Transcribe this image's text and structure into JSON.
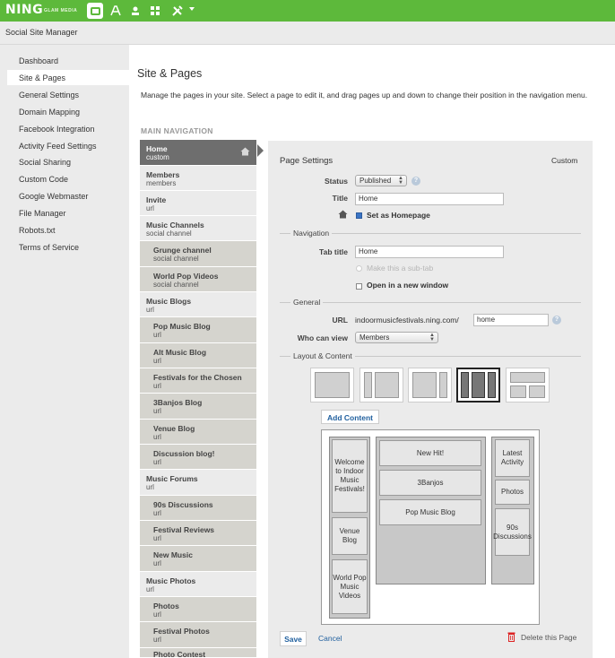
{
  "topbar": {
    "logo": "NING",
    "logo_sub": "GLAM MEDIA",
    "icons": [
      "manage-icon",
      "appearance-icon",
      "members-icon",
      "features-icon",
      "tools-icon"
    ]
  },
  "subheader": {
    "title": "Social Site Manager"
  },
  "sidebar": {
    "items": [
      {
        "label": "Dashboard"
      },
      {
        "label": "Site & Pages",
        "active": true
      },
      {
        "label": "General Settings"
      },
      {
        "label": "Domain Mapping"
      },
      {
        "label": "Facebook Integration"
      },
      {
        "label": "Activity Feed Settings"
      },
      {
        "label": "Social Sharing"
      },
      {
        "label": "Custom Code"
      },
      {
        "label": "Google Webmaster"
      },
      {
        "label": "File Manager"
      },
      {
        "label": "Robots.txt"
      },
      {
        "label": "Terms of Service"
      }
    ]
  },
  "main": {
    "title": "Site & Pages",
    "intro": "Manage the pages in your site. Select a page to edit it, and drag pages up and down to change their position in the navigation menu.",
    "nav_heading": "MAIN NAVIGATION",
    "pages": [
      {
        "name": "Home",
        "type": "custom",
        "level": 0,
        "selected": true
      },
      {
        "name": "Members",
        "type": "members",
        "level": 0
      },
      {
        "name": "Invite",
        "type": "url",
        "level": 0
      },
      {
        "name": "Music Channels",
        "type": "social channel",
        "level": 0
      },
      {
        "name": "Grunge channel",
        "type": "social channel",
        "level": 1
      },
      {
        "name": "World Pop Videos",
        "type": "social channel",
        "level": 1
      },
      {
        "name": "Music Blogs",
        "type": "url",
        "level": 0
      },
      {
        "name": "Pop Music Blog",
        "type": "url",
        "level": 1
      },
      {
        "name": "Alt Music Blog",
        "type": "url",
        "level": 1
      },
      {
        "name": "Festivals for the Chosen",
        "type": "url",
        "level": 1
      },
      {
        "name": "3Banjos Blog",
        "type": "url",
        "level": 1
      },
      {
        "name": "Venue Blog",
        "type": "url",
        "level": 1
      },
      {
        "name": "Discussion blog!",
        "type": "url",
        "level": 1
      },
      {
        "name": "Music Forums",
        "type": "url",
        "level": 0
      },
      {
        "name": "90s Discussions",
        "type": "url",
        "level": 1
      },
      {
        "name": "Festival Reviews",
        "type": "url",
        "level": 1
      },
      {
        "name": "New Music",
        "type": "url",
        "level": 1
      },
      {
        "name": "Music Photos",
        "type": "url",
        "level": 0
      },
      {
        "name": "Photos",
        "type": "url",
        "level": 1
      },
      {
        "name": "Festival Photos",
        "type": "url",
        "level": 1
      },
      {
        "name": "Photo Contest",
        "type": "",
        "level": 1
      }
    ]
  },
  "settings": {
    "title": "Page Settings",
    "page_type": "Custom",
    "status_label": "Status",
    "status_value": "Published",
    "title_label": "Title",
    "title_value": "Home",
    "homepage_label": "Set as Homepage",
    "homepage_checked": true,
    "navigation_section": "Navigation",
    "tab_title_label": "Tab title",
    "tab_title_value": "Home",
    "subtab_label": "Make this a sub-tab",
    "new_window_label": "Open in a new window",
    "general_section": "General",
    "url_label": "URL",
    "url_prefix": "indoormusicfestivals.ning.com/",
    "url_value": "home",
    "who_label": "Who can view",
    "who_value": "Members",
    "layout_section": "Layout & Content",
    "add_content": "Add Content",
    "left_column": [
      "Welcome to Indoor Music Festivals!",
      "Venue Blog",
      "World Pop Music Videos"
    ],
    "center_column": [
      "New Hit!",
      "3Banjos",
      "Pop Music Blog"
    ],
    "right_column": [
      "Latest Activity",
      "Photos",
      "90s Discussions"
    ],
    "save": "Save",
    "cancel": "Cancel",
    "delete": "Delete this Page"
  }
}
